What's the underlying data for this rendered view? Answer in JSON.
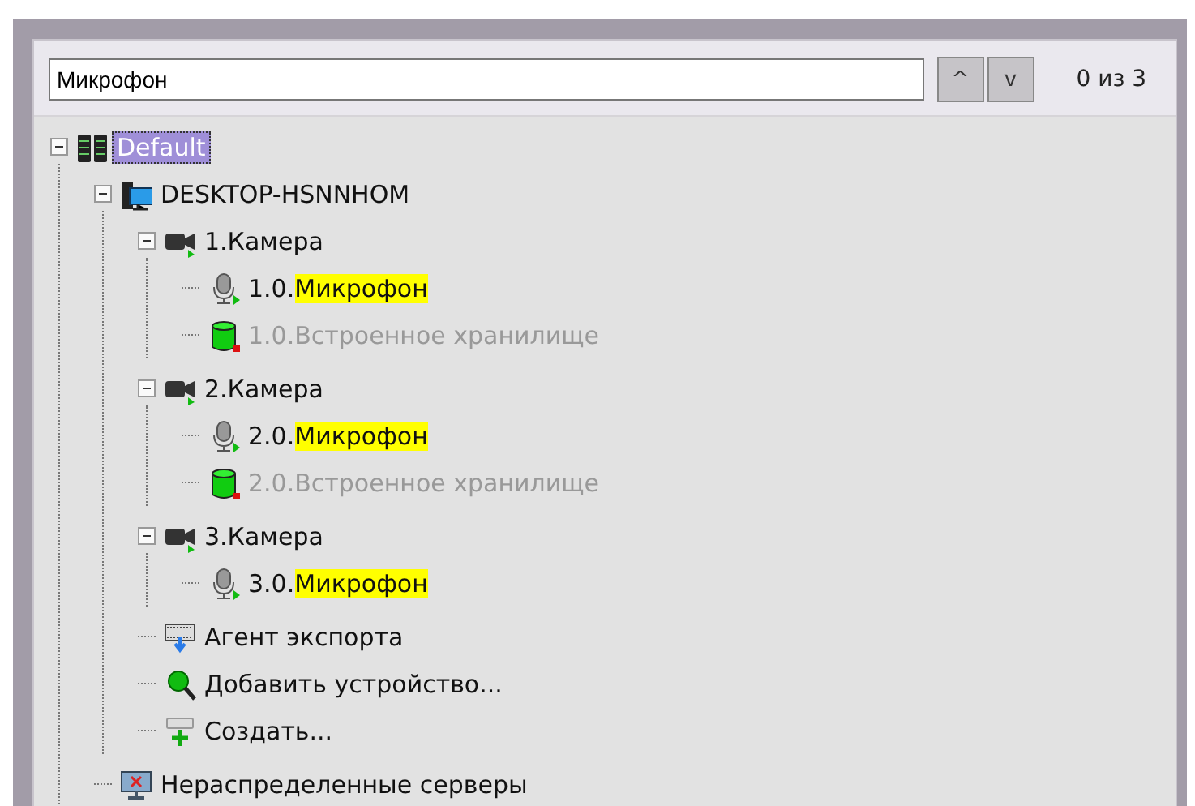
{
  "search": {
    "value": "Микрофон",
    "up_label": "^",
    "down_label": "v",
    "count": "0 из 3"
  },
  "tree": [
    {
      "kind": "server",
      "label": "Default",
      "selected": true,
      "expanded": true,
      "children": [
        {
          "kind": "computer",
          "label": "DESKTOP-HSNNHOM",
          "selected": false,
          "expanded": true,
          "children": [
            {
              "kind": "camera",
              "label": "1.Камера",
              "selected": false,
              "expanded": true,
              "children": [
                {
                  "kind": "microphone",
                  "label": "1.0.",
                  "match": "Микрофон",
                  "selected": false,
                  "disabled": false
                },
                {
                  "kind": "storage",
                  "label": "1.0.Встроенное хранилище",
                  "selected": false,
                  "disabled": true
                }
              ]
            },
            {
              "kind": "camera",
              "label": "2.Камера",
              "selected": false,
              "expanded": true,
              "children": [
                {
                  "kind": "microphone",
                  "label": "2.0.",
                  "match": "Микрофон",
                  "selected": false,
                  "disabled": false
                },
                {
                  "kind": "storage",
                  "label": "2.0.Встроенное хранилище",
                  "selected": false,
                  "disabled": true
                }
              ]
            },
            {
              "kind": "camera",
              "label": "3.Камера",
              "selected": false,
              "expanded": true,
              "children": [
                {
                  "kind": "microphone",
                  "label": "3.0.",
                  "match": "Микрофон",
                  "selected": false,
                  "disabled": false
                }
              ]
            },
            {
              "kind": "export",
              "label": "Агент экспорта",
              "selected": false,
              "disabled": false
            },
            {
              "kind": "add",
              "label": "Добавить устройство...",
              "selected": false,
              "disabled": false
            },
            {
              "kind": "create",
              "label": "Создать...",
              "selected": false,
              "disabled": false
            }
          ]
        },
        {
          "kind": "unassigned",
          "label": "Нераспределенные серверы",
          "selected": false,
          "disabled": false
        }
      ]
    }
  ]
}
